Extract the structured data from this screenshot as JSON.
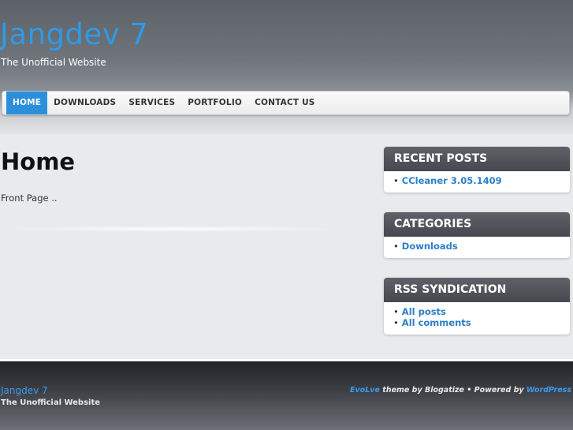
{
  "header": {
    "site_title": "Jangdev 7",
    "tagline": "The Unofficial Website"
  },
  "nav": {
    "items": [
      {
        "label": "HOME",
        "active": true
      },
      {
        "label": "DOWNLOADS"
      },
      {
        "label": "SERVICES"
      },
      {
        "label": "PORTFOLIO"
      },
      {
        "label": "CONTACT US"
      }
    ]
  },
  "main": {
    "heading": "Home",
    "body": "Front Page .."
  },
  "sidebar": {
    "widgets": [
      {
        "title": "RECENT POSTS",
        "links": [
          "CCleaner 3.05.1409"
        ]
      },
      {
        "title": "CATEGORIES",
        "links": [
          "Downloads"
        ]
      },
      {
        "title": "RSS SYNDICATION",
        "links": [
          "All posts",
          "All comments"
        ]
      }
    ]
  },
  "footer": {
    "title": "Jangdev 7",
    "tagline": "The Unofficial Website",
    "theme_name": "EvoLve",
    "theme_by": " theme by Blogatize  •  Powered by ",
    "powered_name": "WordPress"
  },
  "colors": {
    "accent": "#2f9ae6",
    "nav_active": "#2b8fdc",
    "link": "#2b7fc6",
    "widget_header": "#4f5258"
  }
}
